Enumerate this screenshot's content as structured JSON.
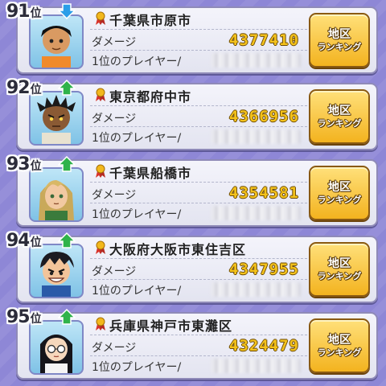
{
  "list": {
    "damage_label": "ダメージ",
    "player_label": "1位のプレイヤー/",
    "button_line1": "地区",
    "button_line2": "ランキング",
    "rank_suffix": "位",
    "rows": [
      {
        "rank": "91",
        "trend": "down",
        "region": "千葉県市原市",
        "damage": "4377410",
        "avatar": "boy-tan-short-hair"
      },
      {
        "rank": "92",
        "trend": "up",
        "region": "東京都府中市",
        "damage": "4366956",
        "avatar": "boy-dark-dreadlocks"
      },
      {
        "rank": "93",
        "trend": "up",
        "region": "千葉県船橋市",
        "damage": "4354581",
        "avatar": "boy-blonde-long-hair"
      },
      {
        "rank": "94",
        "trend": "up",
        "region": "大阪府大阪市東住吉区",
        "damage": "4347955",
        "avatar": "boy-grinning-black-hair"
      },
      {
        "rank": "95",
        "trend": "up",
        "region": "兵庫県神戸市東灘区",
        "damage": "4324479",
        "avatar": "girl-glasses-braids"
      }
    ]
  },
  "colors": {
    "background": "#8e87d6",
    "damage_value": "#f4c21b",
    "button": "#f3b31f",
    "trend_up": "#2fb34a",
    "trend_down": "#2a9ee8"
  }
}
